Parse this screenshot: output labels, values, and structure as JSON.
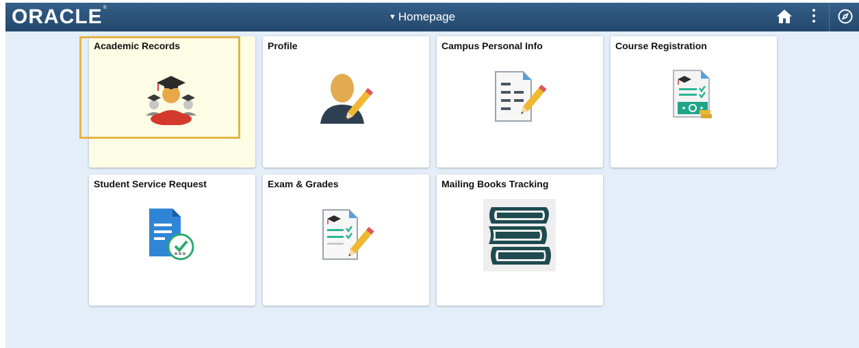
{
  "header": {
    "logo_text": "ORACLE",
    "logo_mark": "®",
    "page_nav_label": "Homepage",
    "icons": [
      "home-icon",
      "more-options-icon",
      "navigator-icon"
    ]
  },
  "tiles": [
    {
      "title": "Academic Records",
      "icon": "graduates-icon",
      "selected": true
    },
    {
      "title": "Profile",
      "icon": "person-edit-icon"
    },
    {
      "title": "Campus Personal Info",
      "icon": "document-edit-icon"
    },
    {
      "title": "Course Registration",
      "icon": "registration-payment-icon"
    },
    {
      "title": "Student Service Request",
      "icon": "document-check-icon"
    },
    {
      "title": "Exam & Grades",
      "icon": "graded-document-edit-icon"
    },
    {
      "title": "Mailing Books Tracking",
      "icon": "books-stack-icon"
    }
  ],
  "colors": {
    "header": "#2b5178",
    "background": "#e4eef8",
    "focus_border": "#e3b545",
    "selected_tile": "#fdfde6"
  }
}
